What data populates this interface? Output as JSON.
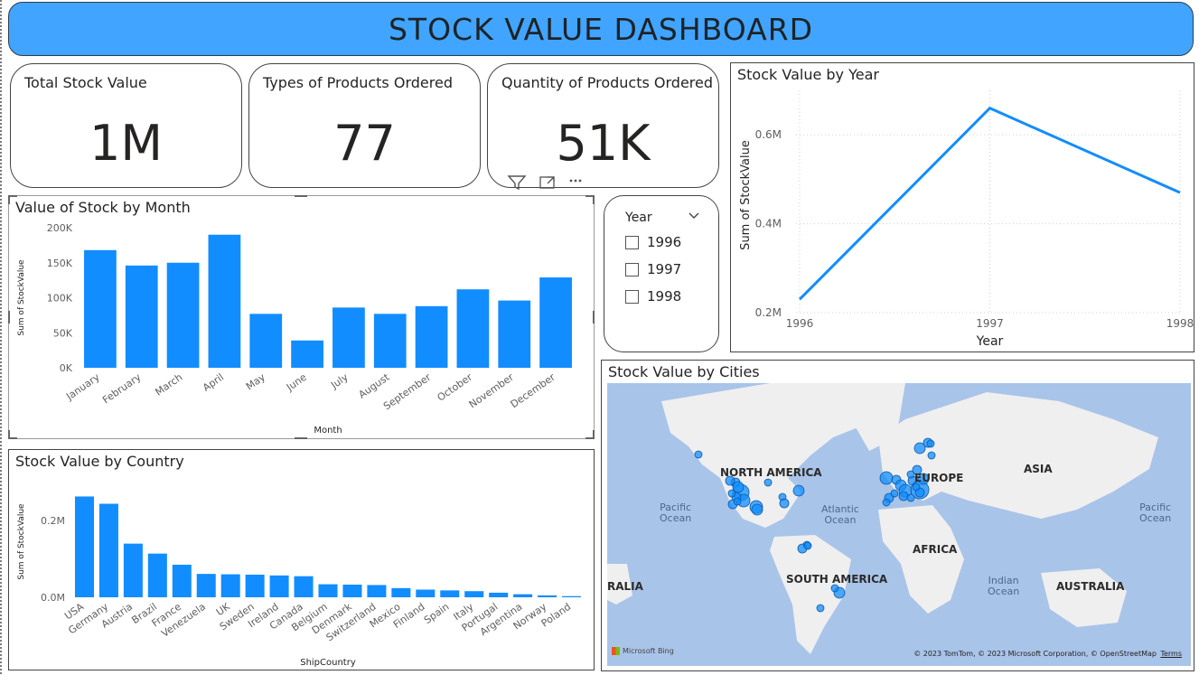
{
  "header": {
    "title": "STOCK VALUE DASHBOARD"
  },
  "cards": [
    {
      "label": "Total Stock Value",
      "value": "1M"
    },
    {
      "label": "Types of Products Ordered",
      "value": "77"
    },
    {
      "label": "Quantity of Products Ordered",
      "value": "51K"
    }
  ],
  "slicer": {
    "header": "Year",
    "items": [
      "1996",
      "1997",
      "1998"
    ]
  },
  "colors": {
    "accent": "#41a5ff",
    "bar": "#118dff",
    "map_water": "#a9c4e9",
    "land": "#efefef"
  },
  "map": {
    "title": "Stock Value by Cities",
    "labels": {
      "na": "NORTH AMERICA",
      "eu": "EUROPE",
      "asia": "ASIA",
      "africa": "AFRICA",
      "sa": "SOUTH AMERICA",
      "aus": "AUSTRALIA",
      "ralia": "RALIA"
    },
    "oceans": {
      "pac1": "Pacific\nOcean",
      "atl": "Atlantic\nOcean",
      "ind": "Indian\nOcean",
      "pac2": "Pacific\nOcean"
    },
    "attribution": "© 2023 TomTom, © 2023 Microsoft Corporation, © OpenStreetMap",
    "terms": "Terms",
    "logo": "Microsoft Bing"
  },
  "chart_data": [
    {
      "type": "line",
      "title": "Stock Value by Year",
      "xlabel": "Year",
      "ylabel": "Sum of StockValue",
      "x": [
        "1996",
        "1997",
        "1998"
      ],
      "values": [
        230000,
        660000,
        470000
      ],
      "yticks": [
        200000,
        400000,
        600000
      ],
      "ytick_labels": [
        "0.2M",
        "0.4M",
        "0.6M"
      ],
      "ylim": [
        200000,
        700000
      ],
      "grid": true
    },
    {
      "type": "bar",
      "title": "Value of Stock by Month",
      "xlabel": "Month",
      "ylabel": "Sum of StockValue",
      "categories": [
        "January",
        "February",
        "March",
        "April",
        "May",
        "June",
        "July",
        "August",
        "September",
        "October",
        "November",
        "December"
      ],
      "values": [
        168000,
        146000,
        150000,
        190000,
        77000,
        39000,
        86000,
        77000,
        88000,
        112000,
        96000,
        129000
      ],
      "yticks": [
        0,
        50000,
        100000,
        150000,
        200000
      ],
      "ytick_labels": [
        "0K",
        "50K",
        "100K",
        "150K",
        "200K"
      ],
      "ylim": [
        0,
        200000
      ],
      "grid": false
    },
    {
      "type": "bar",
      "title": "Stock Value by Country",
      "xlabel": "ShipCountry",
      "ylabel": "Sum of StockValue",
      "categories": [
        "USA",
        "Germany",
        "Austria",
        "Brazil",
        "France",
        "Venezuela",
        "UK",
        "Sweden",
        "Ireland",
        "Canada",
        "Belgium",
        "Denmark",
        "Switzerland",
        "Mexico",
        "Finland",
        "Spain",
        "Italy",
        "Portugal",
        "Argentina",
        "Norway",
        "Poland"
      ],
      "values": [
        263000,
        244000,
        140000,
        114000,
        85000,
        61000,
        60000,
        59000,
        57000,
        55000,
        34000,
        33000,
        32000,
        24000,
        20000,
        18000,
        16000,
        12000,
        8000,
        5000,
        3000
      ],
      "yticks": [
        0,
        200000
      ],
      "ytick_labels": [
        "0.0M",
        "0.2M"
      ],
      "ylim": [
        0,
        290000
      ],
      "grid": false
    }
  ]
}
